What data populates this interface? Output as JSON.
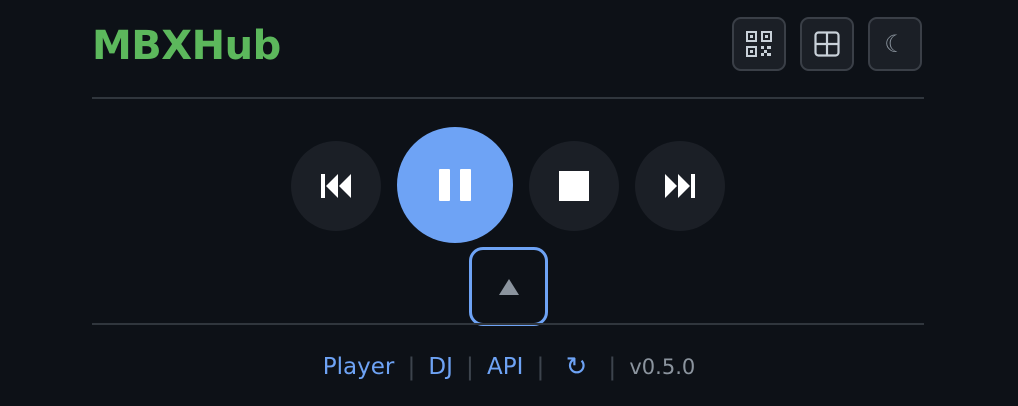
{
  "header": {
    "brand": "MBXHub",
    "buttons": [
      {
        "icon": "qr-code-icon"
      },
      {
        "icon": "grid-layout-icon"
      },
      {
        "icon": "moon-icon",
        "glyph": "☾"
      }
    ]
  },
  "player": {
    "controls": [
      {
        "name": "previous",
        "icon": "skip-previous-icon"
      },
      {
        "name": "pause",
        "icon": "pause-icon"
      },
      {
        "name": "stop",
        "icon": "stop-icon"
      },
      {
        "name": "next",
        "icon": "skip-next-icon"
      }
    ],
    "expand_glyph": "▲"
  },
  "footer": {
    "links": [
      "Player",
      "DJ",
      "API"
    ],
    "separator": "|",
    "refresh_glyph": "↻",
    "version": "v0.5.0"
  },
  "colors": {
    "background": "#0d1117",
    "brand": "#5cb85c",
    "accent": "#6ea3f5",
    "button_bg": "#1b1f26"
  }
}
